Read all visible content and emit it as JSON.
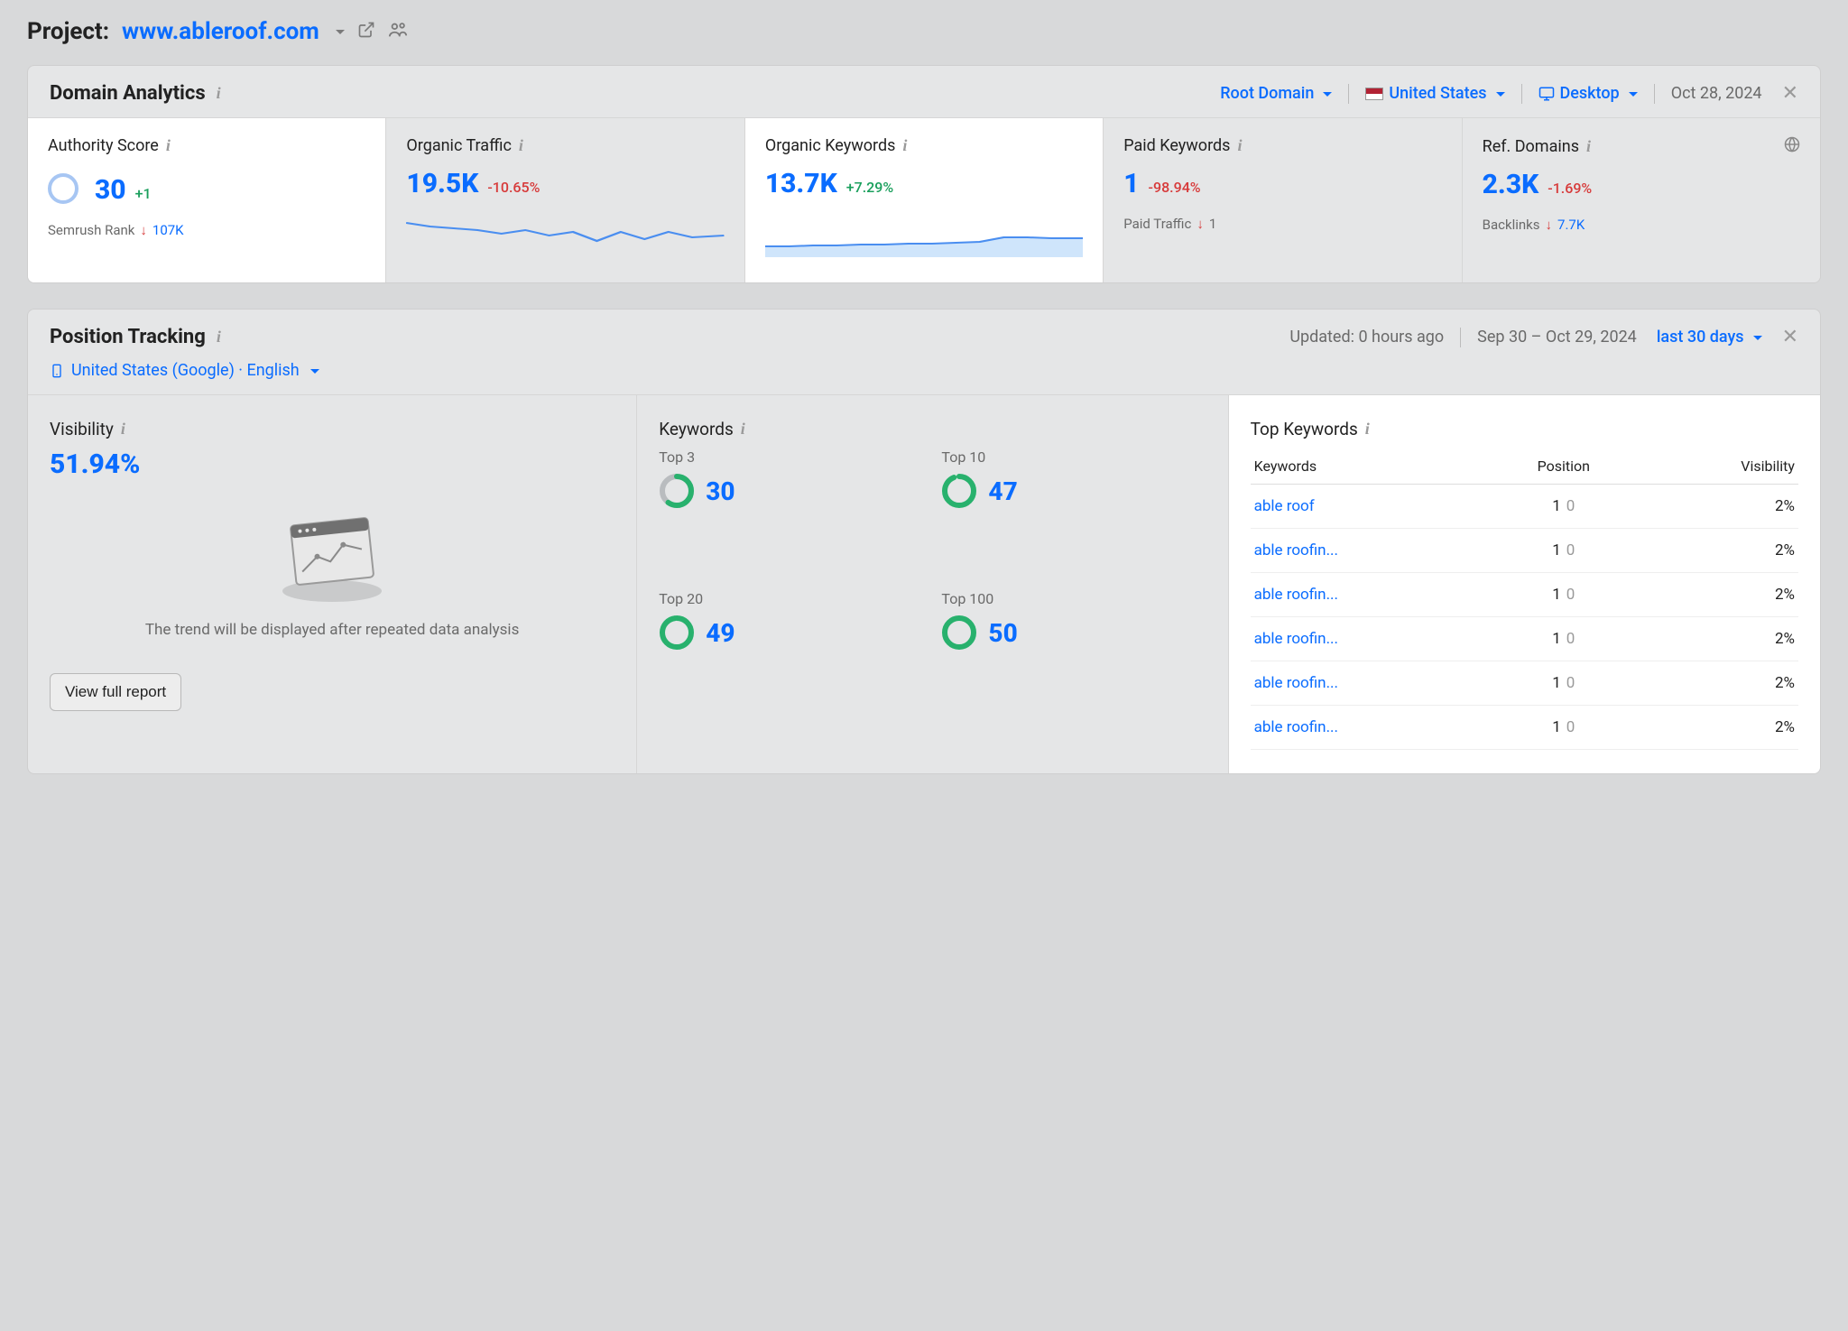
{
  "project": {
    "label": "Project:",
    "domain": "www.ableroof.com"
  },
  "domain_analytics": {
    "title": "Domain Analytics",
    "filters": {
      "scope": "Root Domain",
      "country": "United States",
      "device": "Desktop",
      "date": "Oct 28, 2024"
    },
    "cards": {
      "authority": {
        "title": "Authority Score",
        "value": "30",
        "delta": "+1",
        "sub_label": "Semrush Rank",
        "sub_value": "107K"
      },
      "organic_traffic": {
        "title": "Organic Traffic",
        "value": "19.5K",
        "delta": "-10.65%"
      },
      "organic_keywords": {
        "title": "Organic Keywords",
        "value": "13.7K",
        "delta": "+7.29%"
      },
      "paid_keywords": {
        "title": "Paid Keywords",
        "value": "1",
        "delta": "-98.94%",
        "sub_label": "Paid Traffic",
        "sub_value": "1"
      },
      "ref_domains": {
        "title": "Ref. Domains",
        "value": "2.3K",
        "delta": "-1.69%",
        "sub_label": "Backlinks",
        "sub_value": "7.7K"
      }
    }
  },
  "position_tracking": {
    "title": "Position Tracking",
    "updated": "Updated: 0 hours ago",
    "range": "Sep 30 – Oct 29, 2024",
    "period": "last 30 days",
    "locale": "United States (Google) · English",
    "visibility": {
      "label": "Visibility",
      "value": "51.94%",
      "placeholder": "The trend will be displayed after repeated data analysis",
      "button": "View full report"
    },
    "keywords": {
      "label": "Keywords",
      "groups": [
        {
          "label": "Top 3",
          "value": "30",
          "pct": 60,
          "color": "#28b16d",
          "track": "#b9bcbf"
        },
        {
          "label": "Top 10",
          "value": "47",
          "pct": 94,
          "color": "#28b16d",
          "track": "#d8efe2"
        },
        {
          "label": "Top 20",
          "value": "49",
          "pct": 98,
          "color": "#28b16d",
          "track": "#d8efe2"
        },
        {
          "label": "Top 100",
          "value": "50",
          "pct": 100,
          "color": "#28b16d",
          "track": "#d8efe2"
        }
      ]
    },
    "top_keywords": {
      "label": "Top Keywords",
      "columns": {
        "kw": "Keywords",
        "pos": "Position",
        "vis": "Visibility"
      },
      "rows": [
        {
          "kw": "able roof",
          "pos": "1",
          "pos_delta": "0",
          "vis": "2%"
        },
        {
          "kw": "able roofin...",
          "pos": "1",
          "pos_delta": "0",
          "vis": "2%"
        },
        {
          "kw": "able roofin...",
          "pos": "1",
          "pos_delta": "0",
          "vis": "2%"
        },
        {
          "kw": "able roofin...",
          "pos": "1",
          "pos_delta": "0",
          "vis": "2%"
        },
        {
          "kw": "able roofin...",
          "pos": "1",
          "pos_delta": "0",
          "vis": "2%"
        },
        {
          "kw": "able roofin...",
          "pos": "1",
          "pos_delta": "0",
          "vis": "2%"
        }
      ]
    }
  },
  "chart_data": [
    {
      "type": "line",
      "name": "organic_traffic_spark",
      "x": [
        0,
        1,
        2,
        3,
        4,
        5,
        6,
        7,
        8,
        9,
        10,
        11,
        12,
        13
      ],
      "values": [
        24,
        22,
        21,
        20,
        18,
        20,
        17,
        19,
        14,
        19,
        15,
        19,
        16,
        17
      ],
      "ylim": [
        0,
        28
      ]
    },
    {
      "type": "area",
      "name": "organic_keywords_spark",
      "x": [
        0,
        1,
        2,
        3,
        4,
        5,
        6,
        7,
        8,
        9,
        10,
        11,
        12,
        13
      ],
      "values": [
        10,
        10,
        10.5,
        10.5,
        11,
        11,
        11.5,
        11.5,
        12,
        12.5,
        14,
        14,
        13.8,
        13.7
      ],
      "ylim": [
        0,
        18
      ]
    }
  ]
}
